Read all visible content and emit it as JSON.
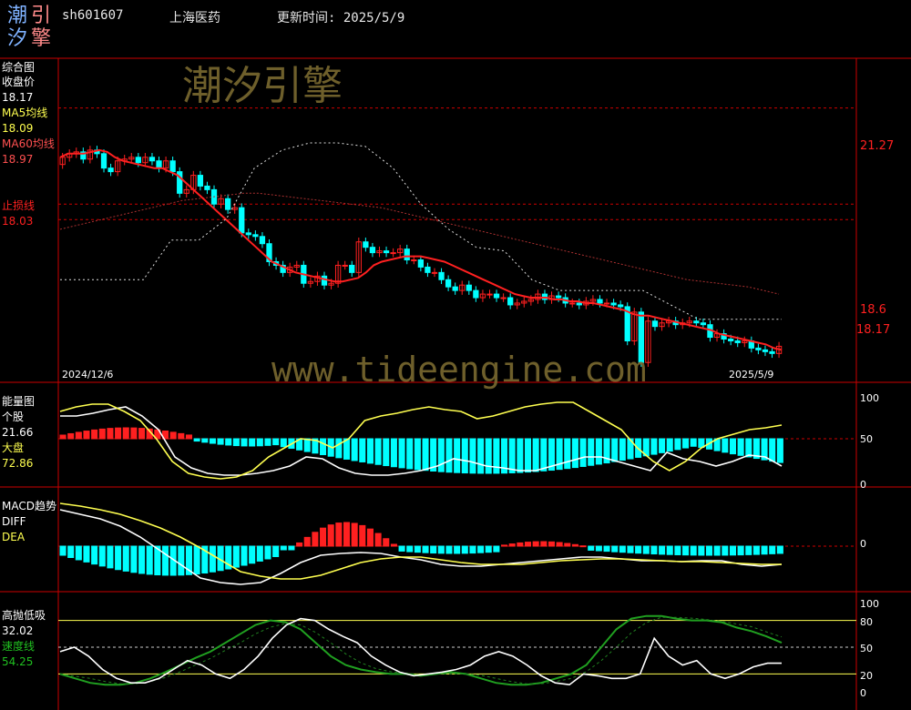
{
  "header": {
    "logo_chars": [
      "潮",
      "引",
      "汐",
      "擎"
    ],
    "code": "sh601607",
    "name": "上海医药",
    "update": "更新时间: 2025/5/9"
  },
  "watermark": {
    "cn": "潮汐引擎",
    "url": "www.tideengine.com"
  },
  "colors": {
    "up": "#ff2020",
    "down": "#00ffff",
    "ma5": "#ffff50",
    "ma60": "#ff4444",
    "stop": "#ff2020",
    "grid": "#cc0000"
  },
  "panels": {
    "price": {
      "title": "综合图",
      "close_label": "收盘价",
      "close_value": "18.17",
      "ma5_label": "MA5均线",
      "ma5_value": "18.09",
      "ma60_label": "MA60均线",
      "ma60_value": "18.97",
      "stop_label": "止损线",
      "stop_value": "18.03",
      "start_date": "2024/12/6",
      "end_date": "2025/5/9",
      "levels": [
        "21.27",
        "18.6",
        "18.17"
      ]
    },
    "energy": {
      "title": "能量图",
      "stock_label": "个股",
      "stock_value": "21.66",
      "market_label": "大盘",
      "market_value": "72.86",
      "ticks": [
        "100",
        "50",
        "0"
      ]
    },
    "macd": {
      "title": "MACD趋势",
      "diff_label": "DIFF",
      "dea_label": "DEA",
      "ticks": [
        "0"
      ]
    },
    "hl": {
      "title": "高抛低吸",
      "value1": "32.02",
      "speed_label": "速度线",
      "speed_value": "54.25",
      "ticks": [
        "100",
        "80",
        "50",
        "20",
        "0"
      ]
    }
  },
  "chart_data": [
    {
      "type": "candlestick",
      "x": [
        "2024/12/6",
        "2025/5/9"
      ],
      "closes": [
        19.9,
        20.0,
        20.05,
        19.85,
        20.1,
        20.0,
        19.6,
        19.5,
        19.8,
        19.85,
        19.9,
        19.75,
        19.9,
        19.8,
        19.6,
        19.8,
        19.5,
        18.9,
        19.0,
        19.4,
        19.1,
        19.0,
        18.6,
        18.75,
        18.45,
        18.5,
        17.8,
        17.75,
        17.7,
        17.5,
        17.0,
        16.9,
        16.7,
        16.85,
        16.9,
        16.4,
        16.45,
        16.6,
        16.35,
        16.4,
        16.9,
        16.9,
        16.7,
        17.55,
        17.4,
        17.25,
        17.3,
        17.25,
        17.25,
        17.35,
        17.05,
        17.05,
        16.85,
        16.7,
        16.7,
        16.5,
        16.3,
        16.2,
        16.35,
        16.2,
        16.0,
        16.1,
        16.1,
        16.0,
        16.0,
        15.8,
        15.85,
        15.9,
        15.95,
        16.1,
        15.95,
        16.05,
        16.0,
        15.85,
        15.85,
        15.8,
        15.9,
        15.95,
        15.85,
        15.85,
        15.8,
        15.75,
        14.8,
        15.6,
        14.2,
        15.35,
        15.2,
        15.3,
        15.35,
        15.25,
        15.3,
        15.35,
        15.3,
        15.25,
        14.9,
        15.0,
        14.85,
        14.8,
        14.75,
        14.8,
        14.6,
        14.55,
        14.5,
        14.45,
        14.65
      ],
      "ma5": [
        19.9,
        20.0,
        20.0,
        20.0,
        20.05,
        20.1,
        20.05,
        19.9,
        19.8,
        19.75,
        19.7,
        19.65,
        19.6,
        19.6,
        19.5,
        19.4,
        19.2,
        19.0,
        18.8,
        18.6,
        18.4,
        18.2,
        18.0,
        17.8,
        17.6,
        17.4,
        17.2,
        17.0,
        16.9,
        16.8,
        16.7,
        16.65,
        16.6,
        16.55,
        16.5,
        16.45,
        16.45,
        16.5,
        16.55,
        16.7,
        16.9,
        17.0,
        17.05,
        17.1,
        17.15,
        17.15,
        17.15,
        17.1,
        17.05,
        17.0,
        16.9,
        16.8,
        16.7,
        16.6,
        16.5,
        16.4,
        16.3,
        16.2,
        16.1,
        16.05,
        16.0,
        16.0,
        16.0,
        15.95,
        15.95,
        15.9,
        15.9,
        15.85,
        15.85,
        15.8,
        15.75,
        15.7,
        15.65,
        15.55,
        15.5,
        15.5,
        15.45,
        15.4,
        15.35,
        15.3,
        15.25,
        15.2,
        15.15,
        15.1,
        15.0,
        14.95,
        14.9,
        14.85,
        14.8,
        14.75,
        14.7,
        14.6,
        14.55
      ],
      "ma60": [
        17.9,
        18.0,
        18.1,
        18.2,
        18.3,
        18.4,
        18.5,
        18.6,
        18.7,
        18.75,
        18.8,
        18.85,
        18.9,
        18.9,
        18.85,
        18.8,
        18.75,
        18.7,
        18.65,
        18.6,
        18.55,
        18.5,
        18.4,
        18.3,
        18.2,
        18.1,
        18.0,
        17.9,
        17.8,
        17.7,
        17.6,
        17.5,
        17.4,
        17.3,
        17.2,
        17.1,
        17.0,
        16.9,
        16.8,
        16.7,
        16.6,
        16.5,
        16.45,
        16.4,
        16.35,
        16.3,
        16.2,
        16.1
      ],
      "stop_line": [
        16.5,
        16.5,
        16.5,
        16.5,
        17.6,
        17.6,
        18.2,
        19.6,
        20.1,
        20.3,
        20.3,
        20.2,
        19.6,
        18.6,
        17.9,
        17.4,
        17.3,
        16.5,
        16.2,
        16.2,
        16.2,
        16.2,
        15.8,
        15.4,
        15.4,
        15.4,
        15.4
      ],
      "levels": [
        21.27,
        18.6,
        18.17
      ]
    },
    {
      "type": "line",
      "ylim": [
        0,
        100
      ],
      "series": [
        {
          "name": "个股",
          "values": [
            75,
            75,
            78,
            82,
            85,
            75,
            60,
            30,
            18,
            12,
            10,
            10,
            12,
            15,
            20,
            30,
            28,
            18,
            12,
            10,
            10,
            12,
            15,
            20,
            28,
            25,
            20,
            18,
            15,
            15,
            20,
            25,
            30,
            30,
            25,
            20,
            15,
            35,
            28,
            25,
            20,
            25,
            32,
            30,
            20
          ]
        },
        {
          "name": "大盘",
          "values": [
            80,
            85,
            88,
            88,
            80,
            70,
            50,
            25,
            12,
            8,
            6,
            8,
            15,
            30,
            40,
            50,
            48,
            40,
            50,
            70,
            75,
            78,
            82,
            85,
            82,
            80,
            72,
            75,
            80,
            85,
            88,
            90,
            90,
            80,
            70,
            60,
            40,
            25,
            15,
            25,
            40,
            50,
            55,
            60,
            62,
            65
          ]
        }
      ]
    },
    {
      "type": "bar",
      "series": [
        {
          "name": "MACD"
        },
        {
          "name": "DIFF"
        },
        {
          "name": "DEA"
        }
      ]
    },
    {
      "type": "line",
      "ylim": [
        0,
        100
      ],
      "series": [
        {
          "name": "高抛低吸",
          "values": [
            45,
            50,
            40,
            25,
            15,
            10,
            10,
            15,
            25,
            35,
            30,
            20,
            15,
            25,
            40,
            60,
            75,
            82,
            80,
            70,
            62,
            55,
            40,
            30,
            22,
            18,
            20,
            22,
            25,
            30,
            40,
            45,
            40,
            30,
            18,
            10,
            8,
            20,
            18,
            15,
            15,
            20,
            60,
            40,
            30,
            35,
            20,
            15,
            20,
            28,
            32,
            32
          ]
        },
        {
          "name": "速度线",
          "values": [
            20,
            15,
            10,
            8,
            8,
            10,
            15,
            22,
            30,
            38,
            45,
            55,
            65,
            75,
            80,
            78,
            70,
            55,
            40,
            30,
            25,
            22,
            20,
            20,
            18,
            20,
            22,
            20,
            15,
            10,
            8,
            8,
            10,
            15,
            20,
            30,
            50,
            70,
            82,
            85,
            85,
            82,
            80,
            80,
            78,
            72,
            68,
            62,
            55
          ]
        }
      ]
    }
  ]
}
